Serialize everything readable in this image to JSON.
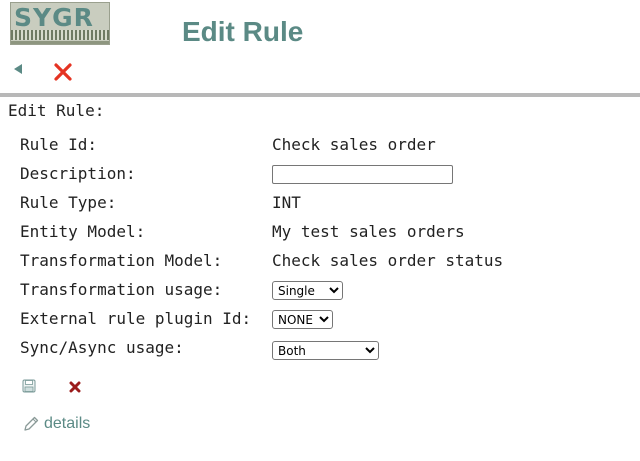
{
  "header": {
    "logo_text": "SYGR",
    "title": "Edit Rule"
  },
  "toolbar": {
    "back_icon": "back-arrow-icon",
    "close_icon": "close-icon",
    "close_color": "#e53322"
  },
  "form": {
    "section_title": "Edit Rule:",
    "rule_id": {
      "label": "Rule Id:",
      "value": "Check sales order"
    },
    "description": {
      "label": "Description:",
      "value": ""
    },
    "rule_type": {
      "label": "Rule Type:",
      "value": "INT"
    },
    "entity_model": {
      "label": "Entity Model:",
      "value": "My test sales orders"
    },
    "transformation_model": {
      "label": "Transformation Model:",
      "value": "Check sales order status"
    },
    "transformation_usage": {
      "label": "Transformation usage:",
      "selected": "Single"
    },
    "external_plugin": {
      "label": "External rule plugin Id:",
      "selected": "NONE"
    },
    "sync_usage": {
      "label": "Sync/Async usage:",
      "selected": "Both"
    }
  },
  "actions": {
    "save_icon": "save-icon",
    "cancel_icon": "cancel-icon",
    "cancel_color": "#9b1c1c",
    "details_label": "details"
  },
  "colors": {
    "accent": "#5b8a85",
    "divider": "#b8b8b8"
  }
}
